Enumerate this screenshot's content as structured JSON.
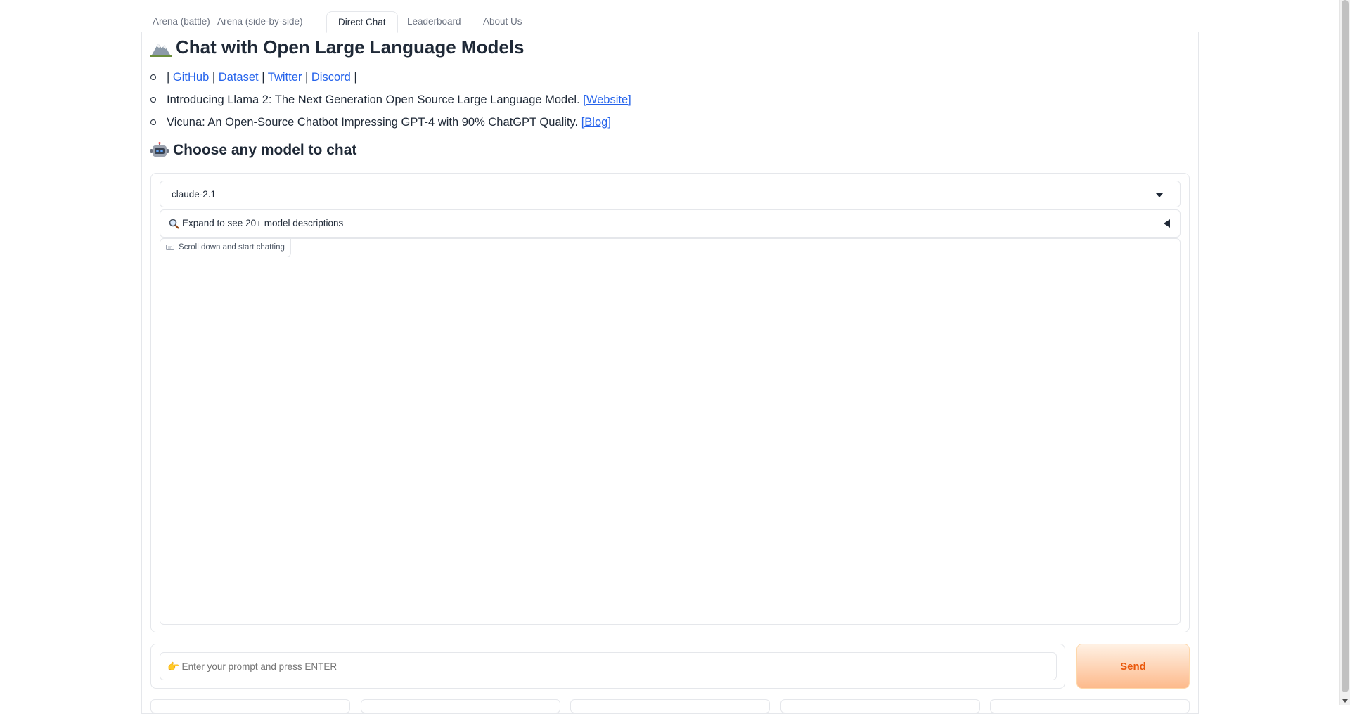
{
  "tabs": [
    {
      "label": "Arena (battle)"
    },
    {
      "label": "Arena (side-by-side)"
    },
    {
      "label": "Direct Chat"
    },
    {
      "label": "Leaderboard"
    },
    {
      "label": "About Us"
    }
  ],
  "active_tab": "Direct Chat",
  "header": {
    "title": "Chat with Open Large Language Models",
    "title_icon": "mountain-icon"
  },
  "links": {
    "separator": "|",
    "github": "GitHub",
    "dataset": "Dataset",
    "twitter": "Twitter",
    "discord": "Discord",
    "llama_text": "Introducing Llama 2: The Next Generation Open Source Large Language Model.",
    "llama_link": "[Website]",
    "vicuna_text": "Vicuna: An Open-Source Chatbot Impressing GPT-4 with 90% ChatGPT Quality.",
    "vicuna_link": "[Blog]"
  },
  "section": {
    "title": "Choose any model to chat",
    "icon": "robot-icon"
  },
  "model_select": {
    "value": "claude-2.1"
  },
  "accordion": {
    "icon": "magnifier-icon",
    "label": "Expand to see 20+ model descriptions"
  },
  "chatbot": {
    "label": "Scroll down and start chatting"
  },
  "prompt": {
    "placeholder": "👉 Enter your prompt and press ENTER",
    "value": ""
  },
  "send_button": {
    "label": "Send"
  },
  "colors": {
    "link": "#2563eb",
    "send_text": "#ea580c",
    "send_bg_top": "#fff1e4",
    "send_bg_bottom": "#fdba8c",
    "border": "#e5e7eb"
  }
}
